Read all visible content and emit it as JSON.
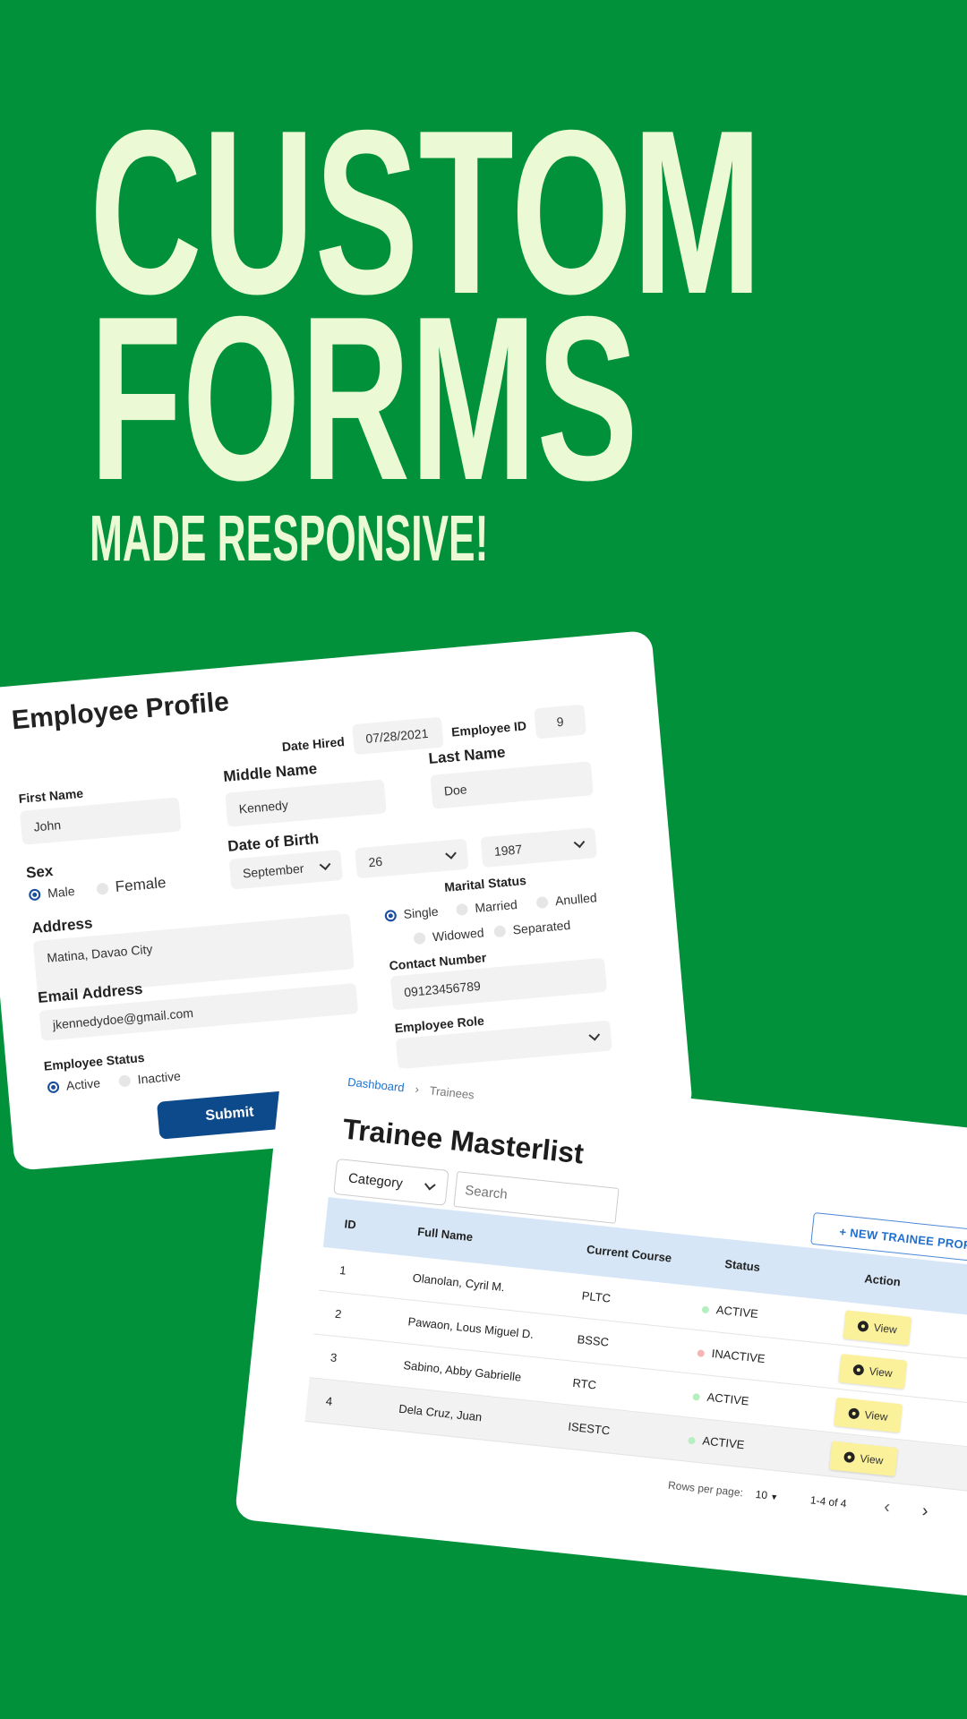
{
  "headline": {
    "line1": "CUSTOM",
    "line2": "FORMS",
    "line3": "MADE RESPONSIVE!"
  },
  "colors": {
    "background": "#00913a",
    "headline": "#ebfad4",
    "submit": "#0d4a8c",
    "table_header": "#d6e6f6",
    "view_button": "#fbf19a",
    "active_dot": "#b6efbf",
    "inactive_dot": "#f5b5b5"
  },
  "profile": {
    "title": "Employee Profile",
    "date_hired_label": "Date Hired",
    "date_hired": "07/28/2021",
    "employee_id_label": "Employee ID",
    "employee_id": "9",
    "first_name_label": "First Name",
    "first_name": "John",
    "middle_name_label": "Middle Name",
    "middle_name": "Kennedy",
    "last_name_label": "Last Name",
    "last_name": "Doe",
    "dob_label": "Date of Birth",
    "dob_month": "September",
    "dob_day": "26",
    "dob_year": "1987",
    "sex_label": "Sex",
    "sex_options": [
      "Male",
      "Female"
    ],
    "sex_selected": "Male",
    "marital_label": "Marital Status",
    "marital_options": [
      "Single",
      "Married",
      "Anulled",
      "Widowed",
      "Separated"
    ],
    "marital_selected": "Single",
    "address_label": "Address",
    "address": "Matina, Davao City",
    "contact_label": "Contact Number",
    "contact": "09123456789",
    "email_label": "Email Address",
    "email": "jkennedydoe@gmail.com",
    "role_label": "Employee Role",
    "role": "",
    "status_label": "Employee Status",
    "status_options": [
      "Active",
      "Inactive"
    ],
    "status_selected": "Active",
    "submit": "Submit"
  },
  "masterlist": {
    "breadcrumb": [
      "Dashboard",
      "Trainees"
    ],
    "title": "Trainee Masterlist",
    "category": "Category",
    "search_placeholder": "Search",
    "new_button": "+ NEW TRAINEE PROFILE",
    "columns": [
      "ID",
      "Full Name",
      "Current Course",
      "Status",
      "Action"
    ],
    "rows": [
      {
        "id": "1",
        "name": "Olanolan, Cyril M.",
        "course": "PLTC",
        "status": "ACTIVE",
        "action": "View"
      },
      {
        "id": "2",
        "name": "Pawaon, Lous Miguel D.",
        "course": "BSSC",
        "status": "INACTIVE",
        "action": "View"
      },
      {
        "id": "3",
        "name": "Sabino, Abby Gabrielle",
        "course": "RTC",
        "status": "ACTIVE",
        "action": "View"
      },
      {
        "id": "4",
        "name": "Dela Cruz, Juan",
        "course": "ISESTC",
        "status": "ACTIVE",
        "action": "View"
      }
    ],
    "rows_per_page_label": "Rows per page:",
    "rows_per_page": "10",
    "range": "1-4 of 4"
  }
}
